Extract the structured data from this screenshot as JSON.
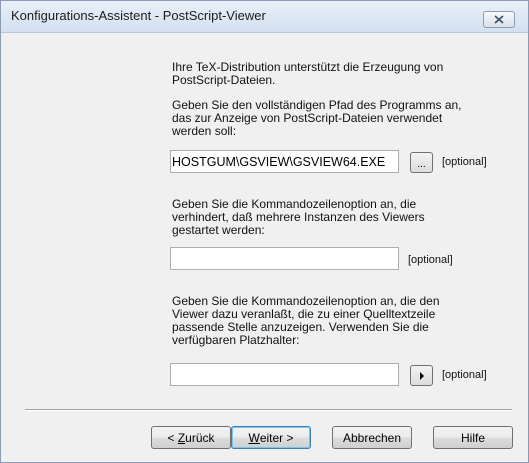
{
  "window": {
    "title": "Konfigurations-Assistent - PostScript-Viewer"
  },
  "info": {
    "line1": "Ihre TeX-Distribution unterstützt die Erzeugung von",
    "line2": "PostScript-Dateien."
  },
  "program": {
    "prompt_line1": "Geben Sie den vollständigen Pfad des Programms an,",
    "prompt_line2": "das zur Anzeige von PostScript-Dateien verwendet",
    "prompt_line3": "werden soll:",
    "path_value": "HOSTGUM\\GSVIEW\\GSVIEW64.EXE",
    "browse_label": "...",
    "optional_label": "[optional]"
  },
  "single_instance": {
    "prompt_line1": "Geben Sie die Kommandozeilenoption an, die",
    "prompt_line2": "verhindert, daß mehrere Instanzen des Viewers",
    "prompt_line3": "gestartet werden:",
    "value": "",
    "optional_label": "[optional]"
  },
  "goto_line": {
    "prompt_line1": "Geben Sie die Kommandozeilenoption an, die den",
    "prompt_line2": "Viewer dazu veranlaßt, die zu einer Quelltextzeile",
    "prompt_line3": "passende Stelle anzuzeigen. Verwenden Sie die",
    "prompt_line4": "verfügbaren Platzhalter:",
    "value": "",
    "placeholder_menu_icon": "right-arrow-icon",
    "optional_label": "[optional]"
  },
  "buttons": {
    "back_prefix": "< ",
    "back_mnemonic": "Z",
    "back_rest": "urück",
    "next_mnemonic": "W",
    "next_rest": "eiter >",
    "cancel": "Abbrechen",
    "help": "Hilfe"
  },
  "icons": {
    "close": "close-icon"
  },
  "colors": {
    "titlebar_top": "#e9f0f9",
    "titlebar_bottom": "#d3e0f0",
    "dialog_bg": "#f0f0f0",
    "default_button_border": "#3c7fb1"
  }
}
